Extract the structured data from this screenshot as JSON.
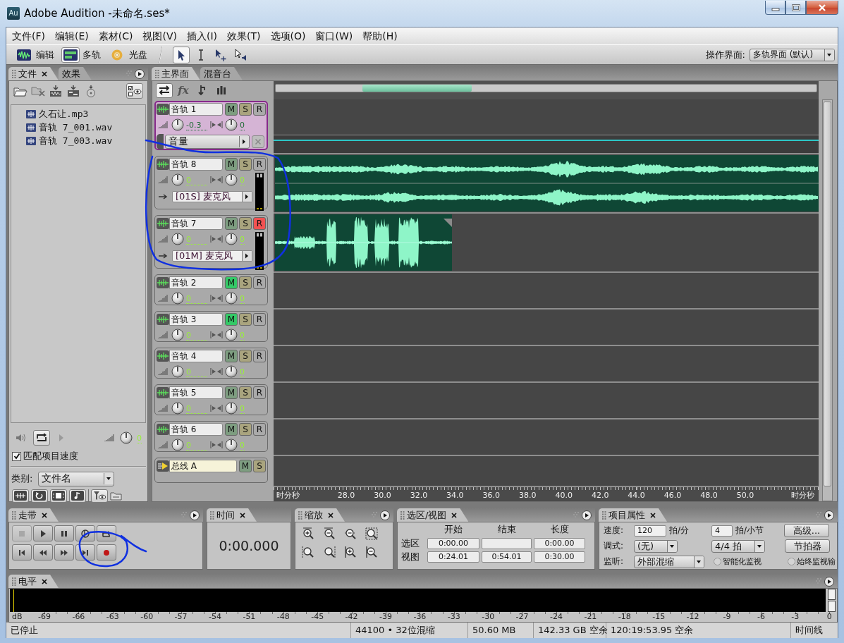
{
  "window": {
    "app_icon": "Au",
    "title": "Adobe Audition -未命名.ses*"
  },
  "menu": [
    "文件(F)",
    "编辑(E)",
    "素材(C)",
    "视图(V)",
    "插入(I)",
    "效果(T)",
    "选项(O)",
    "窗口(W)",
    "帮助(H)"
  ],
  "toolbar": {
    "views": [
      {
        "label": "编辑",
        "selected": false
      },
      {
        "label": "多轨",
        "selected": true
      },
      {
        "label": "光盘",
        "selected": false
      }
    ],
    "tools": [
      {
        "selected": true
      },
      {
        "selected": false
      },
      {
        "selected": false
      },
      {
        "selected": false
      }
    ],
    "workspace": {
      "label": "操作界面:",
      "value": "多轨界面 (默认)"
    }
  },
  "files_panel": {
    "tabs": [
      {
        "label": "文件",
        "selected": true
      },
      {
        "label": "效果",
        "selected": false
      }
    ],
    "files": [
      "久石让.mp3",
      "音轨 7_001.wav",
      "音轨 7_003.wav"
    ],
    "preview_volume": "0",
    "match_tempo": {
      "label": "匹配项目速度",
      "checked": true
    },
    "category": {
      "label": "类别:",
      "value": "文件名"
    }
  },
  "editor": {
    "tabs": [
      {
        "label": "主界面",
        "selected": true
      },
      {
        "label": "混音台",
        "selected": false
      }
    ],
    "tools": [
      {
        "selected": true
      },
      {
        "selected": false,
        "label": "fx"
      },
      {
        "selected": false
      },
      {
        "selected": false
      }
    ],
    "tracks": [
      {
        "kind": "audio",
        "name": "音轨 1",
        "selected": true,
        "buttons": [
          {
            "kind": "mute",
            "label": "M",
            "on": false
          },
          {
            "kind": "solo",
            "label": "S",
            "on": false
          },
          {
            "kind": "record",
            "label": "R",
            "on": false
          }
        ],
        "volume": "-0.3",
        "pan": "0",
        "automation": "音量"
      },
      {
        "kind": "audio",
        "name": "音轨 8",
        "selected": false,
        "buttons": [
          {
            "kind": "mute",
            "label": "M",
            "on": false
          },
          {
            "kind": "solo",
            "label": "S",
            "on": false
          },
          {
            "kind": "record",
            "label": "R",
            "on": false
          }
        ],
        "volume": "0",
        "pan": "0",
        "input": "[01S] 麦克风",
        "clip": {
          "kind": "stereo"
        }
      },
      {
        "kind": "audio",
        "name": "音轨 7",
        "selected": false,
        "buttons": [
          {
            "kind": "mute",
            "label": "M",
            "on": false
          },
          {
            "kind": "solo",
            "label": "S",
            "on": false
          },
          {
            "kind": "record",
            "label": "R",
            "on": true
          }
        ],
        "volume": "0",
        "pan": "0",
        "input": "[01M] 麦克风",
        "clip": {
          "kind": "mono"
        }
      },
      {
        "kind": "audio",
        "name": "音轨 2",
        "selected": false,
        "buttons": [
          {
            "kind": "mute",
            "label": "M",
            "on": true
          },
          {
            "kind": "solo",
            "label": "S",
            "on": false
          },
          {
            "kind": "record",
            "label": "R",
            "on": false
          }
        ],
        "volume": "0",
        "pan": "0"
      },
      {
        "kind": "audio",
        "name": "音轨 3",
        "selected": false,
        "buttons": [
          {
            "kind": "mute",
            "label": "M",
            "on": true
          },
          {
            "kind": "solo",
            "label": "S",
            "on": false
          },
          {
            "kind": "record",
            "label": "R",
            "on": false
          }
        ],
        "volume": "0",
        "pan": "0"
      },
      {
        "kind": "audio",
        "name": "音轨 4",
        "selected": false,
        "buttons": [
          {
            "kind": "mute",
            "label": "M",
            "on": false
          },
          {
            "kind": "solo",
            "label": "S",
            "on": false
          },
          {
            "kind": "record",
            "label": "R",
            "on": false
          }
        ],
        "volume": "0",
        "pan": "0"
      },
      {
        "kind": "audio",
        "name": "音轨 5",
        "selected": false,
        "buttons": [
          {
            "kind": "mute",
            "label": "M",
            "on": false
          },
          {
            "kind": "solo",
            "label": "S",
            "on": false
          },
          {
            "kind": "record",
            "label": "R",
            "on": false
          }
        ],
        "volume": "0",
        "pan": "0"
      },
      {
        "kind": "audio",
        "name": "音轨 6",
        "selected": false,
        "buttons": [
          {
            "kind": "mute",
            "label": "M",
            "on": false
          },
          {
            "kind": "solo",
            "label": "S",
            "on": false
          },
          {
            "kind": "record",
            "label": "R",
            "on": false
          }
        ],
        "volume": "0",
        "pan": "0"
      },
      {
        "kind": "bus",
        "name": "总线 A",
        "selected": false,
        "buttons": [
          {
            "kind": "mute",
            "label": "M",
            "on": false
          },
          {
            "kind": "solo",
            "label": "S",
            "on": false
          }
        ]
      }
    ],
    "ruler": {
      "start_label": "时分秒",
      "ticks": [
        "28.0",
        "30.0",
        "32.0",
        "34.0",
        "36.0",
        "38.0",
        "40.0",
        "42.0",
        "44.0",
        "46.0",
        "48.0",
        "50.0"
      ],
      "end_label": "时分秒"
    }
  },
  "transport": {
    "title": "走带",
    "buttons": [
      {
        "disabled": true
      },
      {
        "disabled": false
      },
      {
        "disabled": false
      },
      {
        "disabled": false
      },
      {
        "disabled": false
      },
      {
        "disabled": false
      },
      {
        "disabled": false
      },
      {
        "disabled": false
      },
      {
        "disabled": false
      },
      {
        "disabled": false
      }
    ]
  },
  "time": {
    "title": "时间",
    "value": "0:00.000"
  },
  "zoom": {
    "title": "缩放"
  },
  "selection_view": {
    "title": "选区/视图",
    "columns": [
      "开始",
      "结束",
      "长度"
    ],
    "rows": [
      {
        "label": "选区",
        "start": "0:00.00",
        "length": "0:00.00"
      },
      {
        "label": "视图",
        "start": "0:24.01",
        "end": "0:54.01",
        "length": "0:30.00"
      }
    ]
  },
  "project": {
    "title": "项目属性",
    "tempo_label": "速度:",
    "tempo": "120",
    "tempo_unit": "拍/分",
    "beats": "4",
    "beats_unit": "拍/小节",
    "advanced": "高级...",
    "key_label": "调式:",
    "key": "(无)",
    "time_signature": "4/4 拍",
    "metronome": "节拍器",
    "monitor_label": "监听:",
    "monitor": "外部混缩",
    "options": [
      {
        "label": "智能化监视",
        "selected": false
      },
      {
        "label": "始终监视输",
        "selected": false
      }
    ]
  },
  "levels": {
    "title": "电平",
    "unit": "dB",
    "scale": [
      "-69",
      "-66",
      "-63",
      "-60",
      "-57",
      "-54",
      "-51",
      "-48",
      "-45",
      "-42",
      "-39",
      "-36",
      "-33",
      "-30",
      "-27",
      "-24",
      "-21",
      "-18",
      "-15",
      "-12",
      "-9",
      "-6",
      "-3",
      "0"
    ]
  },
  "status_bar": [
    "已停止",
    "44100 • 32位混缩",
    "50.60 MB",
    "142.33 GB 空余",
    "120:19:53.95 空余",
    "时间线"
  ]
}
